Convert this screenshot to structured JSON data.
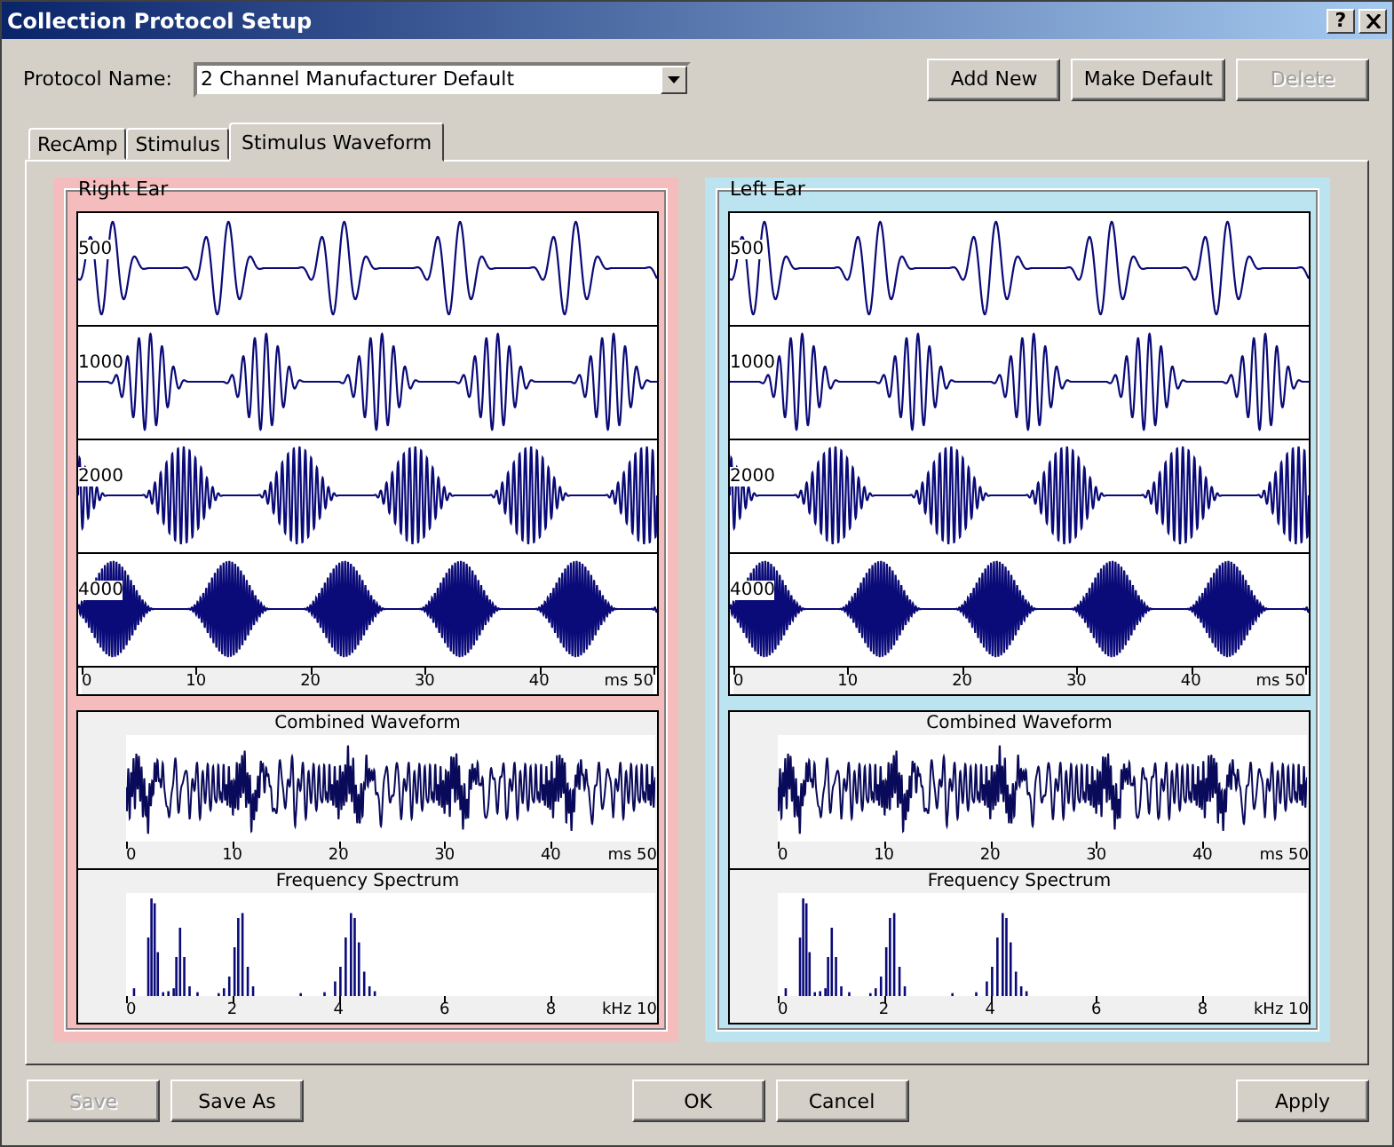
{
  "window": {
    "title": "Collection Protocol Setup",
    "help": "?"
  },
  "protocol": {
    "label": "Protocol Name:",
    "value": "2 Channel Manufacturer Default"
  },
  "top_buttons": [
    {
      "label": "Add New",
      "disabled": false
    },
    {
      "label": "Make Default",
      "disabled": false
    },
    {
      "label": "Delete",
      "disabled": true
    }
  ],
  "tabs": [
    {
      "label": "RecAmp",
      "selected": false
    },
    {
      "label": "Stimulus",
      "selected": false
    },
    {
      "label": "Stimulus Waveform",
      "selected": true
    }
  ],
  "ears": [
    {
      "title": "Right Ear",
      "color": "#f4bcbc",
      "tones": [
        {
          "label": "500"
        },
        {
          "label": "1000"
        },
        {
          "label": "2000"
        },
        {
          "label": "4000"
        }
      ],
      "time_axis": [
        "0",
        "10",
        "20",
        "30",
        "40",
        "ms 50"
      ],
      "combined": {
        "title": "Combined Waveform",
        "axis": [
          "0",
          "10",
          "20",
          "30",
          "40",
          "ms 50"
        ]
      },
      "spectrum": {
        "title": "Frequency  Spectrum",
        "axis": [
          "0",
          "2",
          "4",
          "6",
          "8",
          "kHz 10"
        ]
      }
    },
    {
      "title": "Left Ear",
      "color": "#bce4f0",
      "tones": [
        {
          "label": "500"
        },
        {
          "label": "1000"
        },
        {
          "label": "2000"
        },
        {
          "label": "4000"
        }
      ],
      "time_axis": [
        "0",
        "10",
        "20",
        "30",
        "40",
        "ms 50"
      ],
      "combined": {
        "title": "Combined Waveform",
        "axis": [
          "0",
          "10",
          "20",
          "30",
          "40",
          "ms 50"
        ]
      },
      "spectrum": {
        "title": "Frequency  Spectrum",
        "axis": [
          "0",
          "2",
          "4",
          "6",
          "8",
          "kHz 10"
        ]
      }
    }
  ],
  "bottom_left": [
    {
      "label": "Save",
      "disabled": true
    },
    {
      "label": "Save As",
      "disabled": false
    }
  ],
  "bottom_center": [
    {
      "label": "OK",
      "disabled": false
    },
    {
      "label": "Cancel",
      "disabled": false
    }
  ],
  "bottom_right": [
    {
      "label": "Apply",
      "disabled": false
    }
  ]
}
